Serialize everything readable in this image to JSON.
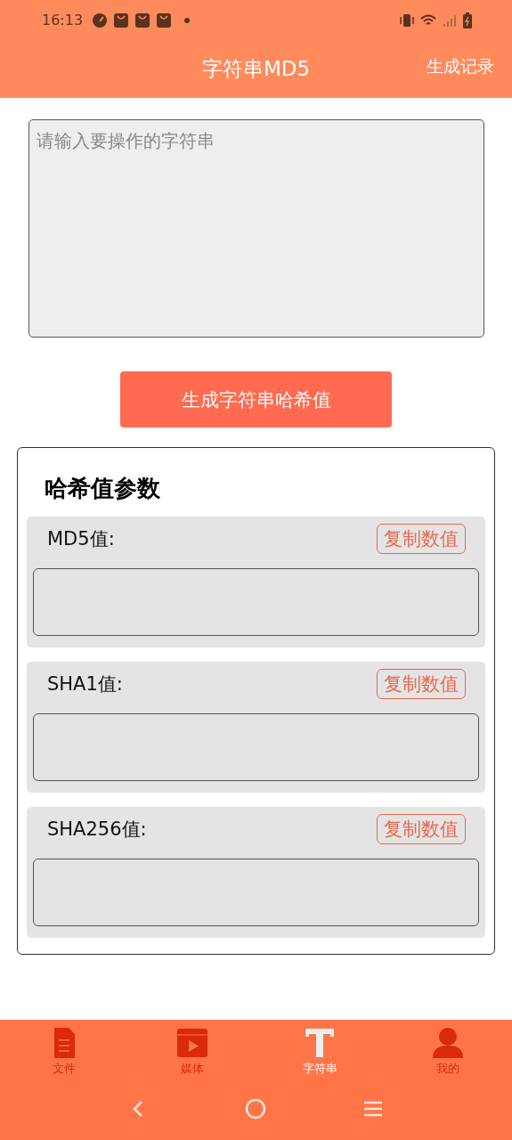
{
  "status_bar": {
    "time": "16:13"
  },
  "header": {
    "title": "字符串MD5",
    "action": "生成记录"
  },
  "input": {
    "placeholder": "请输入要操作的字符串"
  },
  "generate_button": "生成字符串哈希值",
  "hash_panel": {
    "title": "哈希值参数",
    "items": [
      {
        "label": "MD5值:",
        "copy_button": "复制数值"
      },
      {
        "label": "SHA1值:",
        "copy_button": "复制数值"
      },
      {
        "label": "SHA256值:",
        "copy_button": "复制数值"
      }
    ]
  },
  "tabs": [
    {
      "kind": "file",
      "label": "文件",
      "selected": false
    },
    {
      "kind": "media",
      "label": "媒体",
      "selected": false
    },
    {
      "kind": "text",
      "label": "字符串",
      "selected": true
    },
    {
      "kind": "user",
      "label": "我的",
      "selected": false
    }
  ]
}
